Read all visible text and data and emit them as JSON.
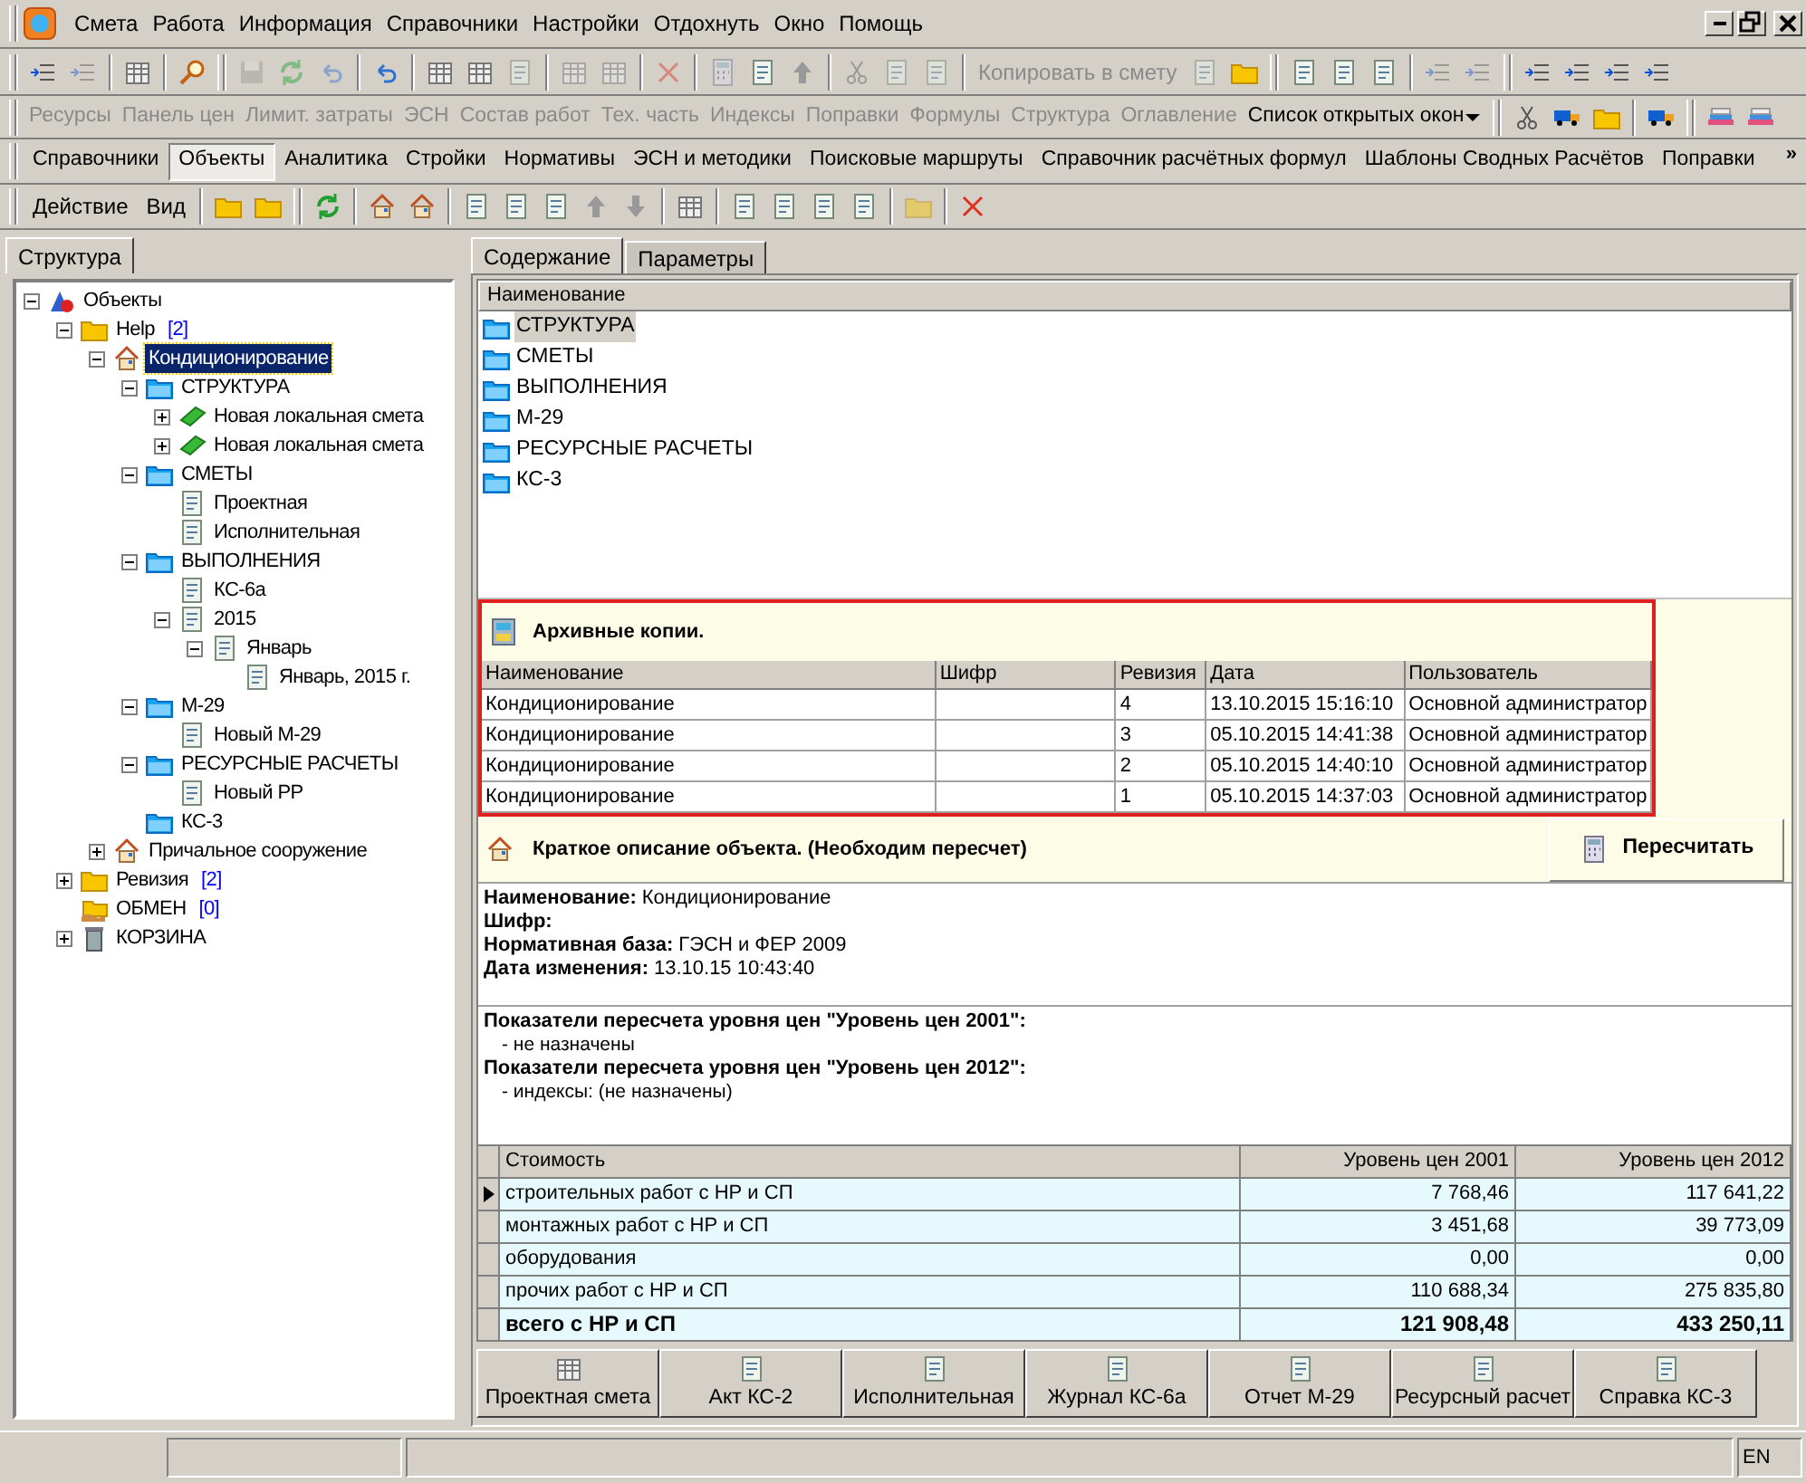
{
  "menu": [
    "Смета",
    "Работа",
    "Информация",
    "Справочники",
    "Настройки",
    "Отдохнуть",
    "Окно",
    "Помощь"
  ],
  "toolbar_copy": {
    "label": "Копировать в смету",
    "disabled": true
  },
  "links_toolbar": [
    {
      "label": "Ресурсы",
      "disabled": true
    },
    {
      "label": "Панель цен",
      "disabled": true
    },
    {
      "label": "Лимит. затраты",
      "disabled": true
    },
    {
      "label": "ЭСН",
      "disabled": true
    },
    {
      "label": "Состав работ",
      "disabled": true
    },
    {
      "label": "Тех. часть",
      "disabled": true
    },
    {
      "label": "Индексы",
      "disabled": true
    },
    {
      "label": "Поправки",
      "disabled": true
    },
    {
      "label": "Формулы",
      "disabled": true
    },
    {
      "label": "Структура",
      "disabled": true
    },
    {
      "label": "Оглавление",
      "disabled": true
    },
    {
      "label": "Список открытых окон",
      "disabled": false
    }
  ],
  "nav_tabs": [
    {
      "label": "Справочники",
      "selected": false
    },
    {
      "label": "Объекты",
      "selected": true
    },
    {
      "label": "Аналитика",
      "selected": false
    },
    {
      "label": "Стройки",
      "selected": false
    },
    {
      "label": "Нормативы",
      "selected": false
    },
    {
      "label": "ЭСН и методики",
      "selected": false
    },
    {
      "label": "Поисковые маршруты",
      "selected": false
    },
    {
      "label": "Справочник расчётных формул",
      "selected": false
    },
    {
      "label": "Шаблоны Сводных Расчётов",
      "selected": false
    },
    {
      "label": "Поправки",
      "selected": false
    }
  ],
  "nav_more": "»",
  "action_menu": [
    "Действие",
    "Вид"
  ],
  "left_tabs": [
    {
      "label": "Структура",
      "selected": true
    }
  ],
  "tree": [
    {
      "label": "Объекты",
      "kind": "root",
      "expanded": true,
      "selected": false,
      "children": [
        {
          "label": "Help",
          "count": "[2]",
          "kind": "folder",
          "expanded": true,
          "selected": false,
          "children": [
            {
              "label": "Кондиционирование",
              "kind": "object",
              "expanded": true,
              "selected": true,
              "children": [
                {
                  "label": "СТРУКТУРА",
                  "kind": "section",
                  "expanded": true,
                  "selected": false,
                  "children": [
                    {
                      "label": "Новая локальная смета",
                      "kind": "book",
                      "expanded": false,
                      "selected": false
                    },
                    {
                      "label": "Новая локальная смета",
                      "kind": "book",
                      "expanded": false,
                      "selected": false
                    }
                  ]
                },
                {
                  "label": "СМЕТЫ",
                  "kind": "section",
                  "expanded": true,
                  "selected": false,
                  "children": [
                    {
                      "label": "Проектная",
                      "kind": "doc",
                      "selected": false
                    },
                    {
                      "label": "Исполнительная",
                      "kind": "doc",
                      "selected": false
                    }
                  ]
                },
                {
                  "label": "ВЫПОЛНЕНИЯ",
                  "kind": "section",
                  "expanded": true,
                  "selected": false,
                  "children": [
                    {
                      "label": "КС-6а",
                      "kind": "doc",
                      "selected": false
                    },
                    {
                      "label": "2015",
                      "kind": "doc",
                      "expanded": true,
                      "selected": false,
                      "children": [
                        {
                          "label": "Январь",
                          "kind": "doc",
                          "expanded": true,
                          "selected": false,
                          "children": [
                            {
                              "label": "Январь, 2015 г.",
                              "kind": "doc",
                              "selected": false
                            }
                          ]
                        }
                      ]
                    }
                  ]
                },
                {
                  "label": "М-29",
                  "kind": "section",
                  "expanded": true,
                  "selected": false,
                  "children": [
                    {
                      "label": "Новый М-29",
                      "kind": "doc",
                      "selected": false
                    }
                  ]
                },
                {
                  "label": "РЕСУРСНЫЕ РАСЧЕТЫ",
                  "kind": "section",
                  "expanded": true,
                  "selected": false,
                  "children": [
                    {
                      "label": "Новый РР",
                      "kind": "doc",
                      "selected": false
                    }
                  ]
                },
                {
                  "label": "КС-3",
                  "kind": "section",
                  "selected": false
                }
              ]
            },
            {
              "label": "Причальное сооружение",
              "kind": "object",
              "expanded": false,
              "selected": false
            }
          ]
        },
        {
          "label": "Ревизия",
          "count": "[2]",
          "kind": "folder",
          "expanded": false,
          "selected": false
        },
        {
          "label": "ОБМЕН",
          "count": "[0]",
          "kind": "exchange",
          "selected": false
        },
        {
          "label": "КОРЗИНА",
          "kind": "trash",
          "expanded": false,
          "selected": false
        }
      ]
    }
  ],
  "right_tabs": [
    {
      "label": "Содержание",
      "selected": true
    },
    {
      "label": "Параметры",
      "selected": false
    }
  ],
  "contents": {
    "column": "Наименование",
    "items": [
      {
        "label": "СТРУКТУРА",
        "selected": true
      },
      {
        "label": "СМЕТЫ",
        "selected": false
      },
      {
        "label": "ВЫПОЛНЕНИЯ",
        "selected": false
      },
      {
        "label": "М-29",
        "selected": false
      },
      {
        "label": "РЕСУРСНЫЕ РАСЧЕТЫ",
        "selected": false
      },
      {
        "label": "КС-3",
        "selected": false
      }
    ]
  },
  "archive": {
    "title": "Архивные копии.",
    "columns": [
      "Наименование",
      "Шифр",
      "Ревизия",
      "Дата",
      "Пользователь"
    ],
    "rows": [
      [
        "Кондиционирование",
        "",
        "4",
        "13.10.2015 15:16:10",
        "Основной администратор"
      ],
      [
        "Кондиционирование",
        "",
        "3",
        "05.10.2015 14:41:38",
        "Основной администратор"
      ],
      [
        "Кондиционирование",
        "",
        "2",
        "05.10.2015 14:40:10",
        "Основной администратор"
      ],
      [
        "Кондиционирование",
        "",
        "1",
        "05.10.2015 14:37:03",
        "Основной администратор"
      ]
    ]
  },
  "description": {
    "title": "Краткое описание объекта. (Необходим пересчет)",
    "recalc_button": "Пересчитать",
    "fields": [
      {
        "label": "Наименование:",
        "value": "Кондиционирование"
      },
      {
        "label": "Шифр:"
      },
      {
        "label": "Нормативная база:",
        "value": "ГЭСН и ФЕР 2009"
      },
      {
        "label": "Дата изменения:",
        "value": "13.10.15 10:43:40"
      }
    ],
    "price_levels": [
      {
        "title": "Показатели пересчета уровня цен \"Уровень цен 2001\":",
        "note": "- не назначены"
      },
      {
        "title": "Показатели пересчета уровня цен \"Уровень цен 2012\":",
        "note": "- индексы: (не назначены)"
      }
    ]
  },
  "cost_table": {
    "columns": [
      "Стоимость",
      "Уровень цен 2001",
      "Уровень цен 2012"
    ],
    "rows": [
      {
        "kind": "item",
        "selected": true,
        "cells": [
          "строительных работ с НР и СП",
          "7 768,46",
          "117 641,22"
        ]
      },
      {
        "kind": "item",
        "selected": false,
        "cells": [
          "монтажных работ с НР и СП",
          "3 451,68",
          "39 773,09"
        ]
      },
      {
        "kind": "item",
        "selected": false,
        "cells": [
          "оборудования",
          "0,00",
          "0,00"
        ]
      },
      {
        "kind": "item",
        "selected": false,
        "cells": [
          "прочих работ с НР и СП",
          "110 688,34",
          "275 835,80"
        ]
      },
      {
        "kind": "total",
        "selected": false,
        "cells": [
          "всего с НР и СП",
          "121 908,48",
          "433 250,11"
        ]
      }
    ]
  },
  "bottom_buttons": [
    "Проектная смета",
    "Акт КС-2",
    "Исполнительная",
    "Журнал КС-6а",
    "Отчет М-29",
    "Ресурсный расчет",
    "Справка КС-3"
  ],
  "status_bar": {
    "language": "EN"
  }
}
